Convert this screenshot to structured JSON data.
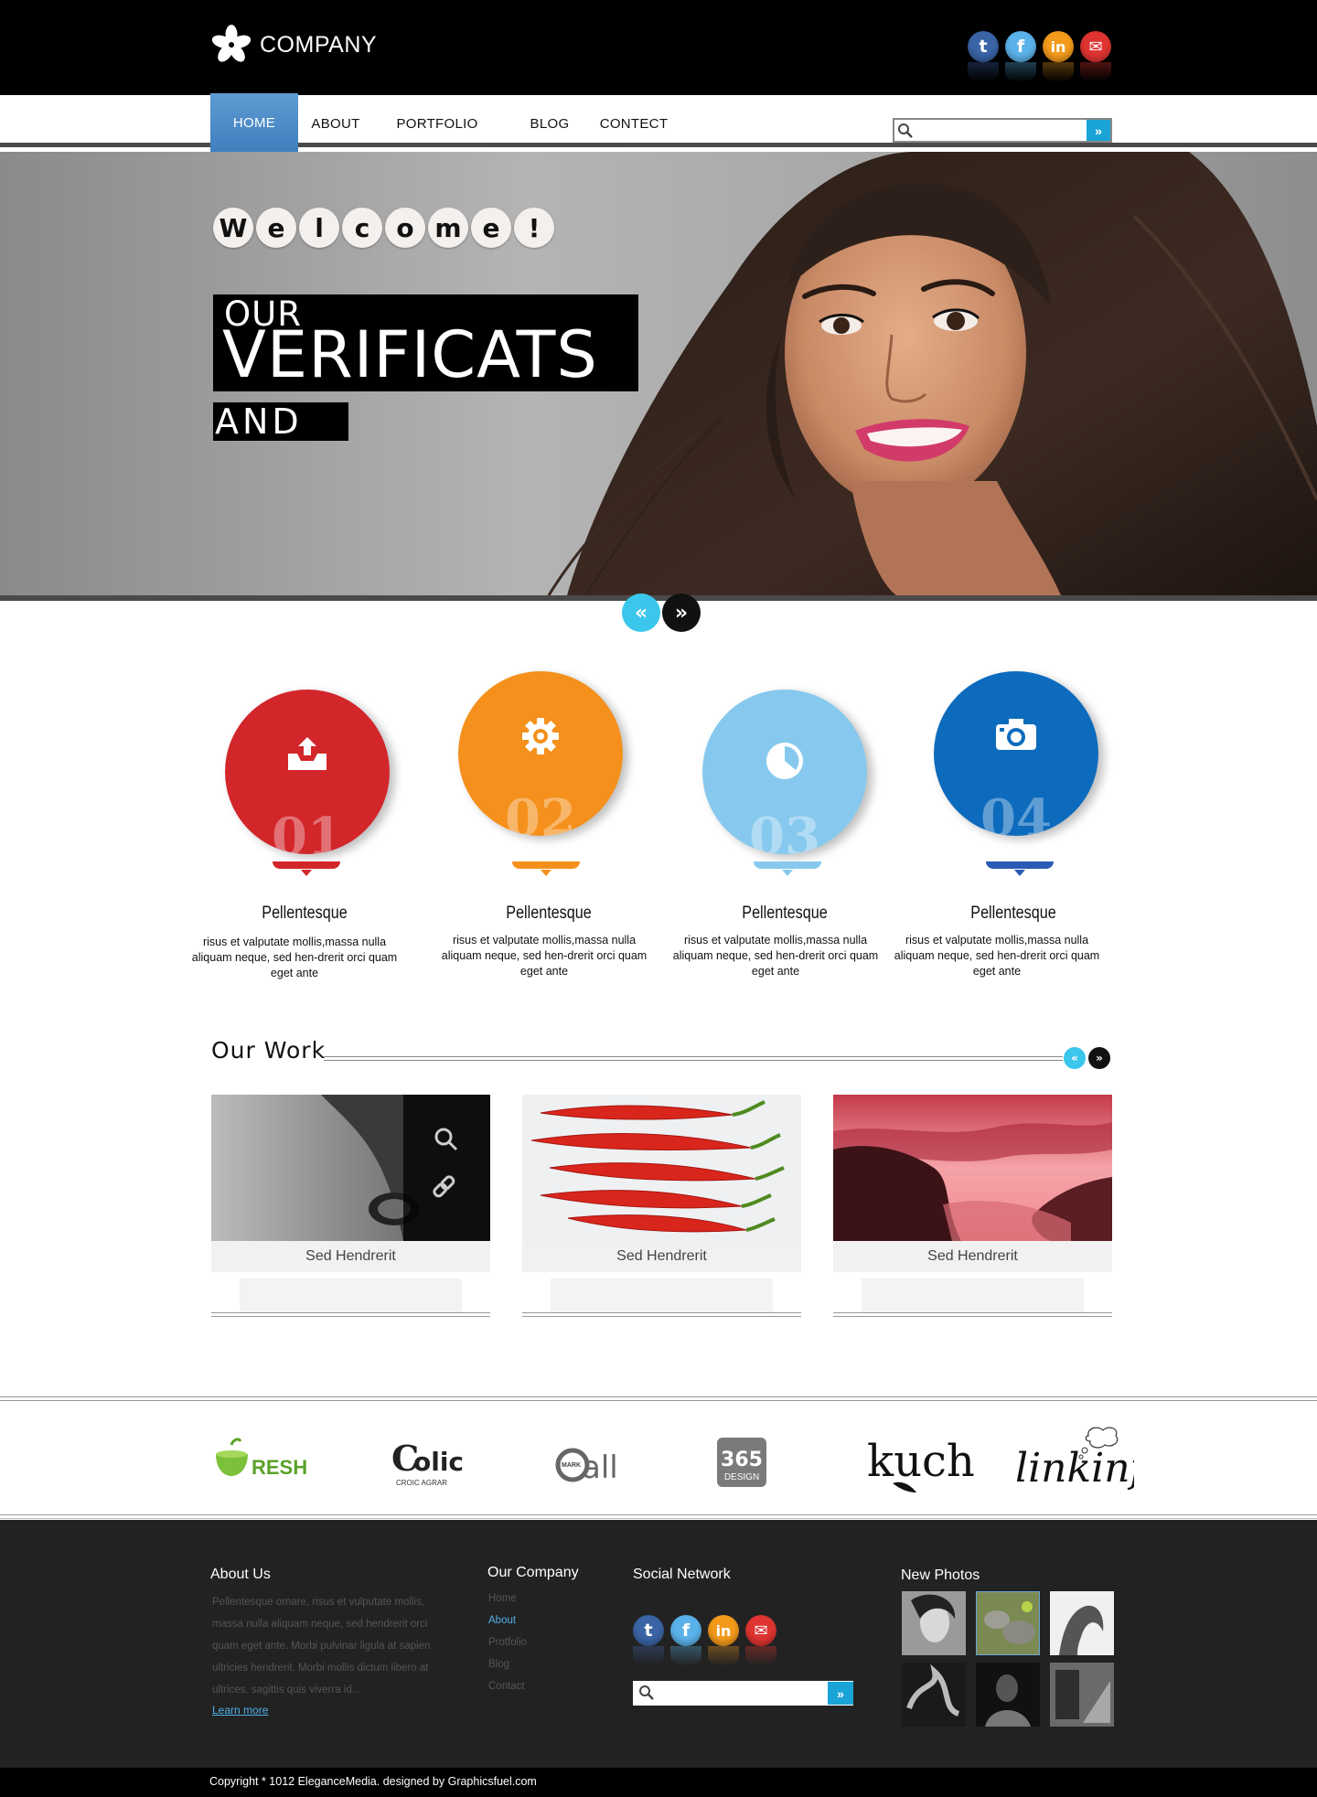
{
  "brand": {
    "logo_text": "COMPANY"
  },
  "social": [
    {
      "icon": "tumblr-icon",
      "glyph": "t",
      "color": "#3a64a6"
    },
    {
      "icon": "facebook-icon",
      "glyph": "f",
      "color": "#5bb2ea"
    },
    {
      "icon": "linkedin-icon",
      "glyph": "in",
      "color": "#f39a1b"
    },
    {
      "icon": "mail-icon",
      "glyph": "✉",
      "color": "#df3431"
    }
  ],
  "nav": {
    "items": [
      "HOME",
      "ABOUT",
      "PORTFOLIO",
      "BLOG",
      "CONTECT"
    ],
    "active": "HOME",
    "search_placeholder": ""
  },
  "hero": {
    "welcome": [
      "W",
      "e",
      "l",
      "c",
      "o",
      "m",
      "e",
      "!"
    ],
    "line1": "OUR",
    "line2": "VERIFICATS",
    "line3": "AND",
    "prev_icon": "«",
    "next_icon": "»"
  },
  "features": [
    {
      "number": "01",
      "title": "Pellentesque",
      "text": "risus et valputate mollis,massa nulla aliquam neque, sed hen-drerit orci quam eget ante",
      "color": "#d2262a",
      "icon": "inbox-upload-icon"
    },
    {
      "number": "02",
      "title": "Pellentesque",
      "text": "risus et valputate mollis,massa nulla aliquam neque, sed hen-drerit orci quam eget ante",
      "color": "#f4901b",
      "icon": "gear-icon"
    },
    {
      "number": "03",
      "title": "Pellentesque",
      "text": "risus et valputate mollis,massa nulla aliquam neque, sed hen-drerit orci quam eget ante",
      "color": "#87c9ee",
      "icon": "pie-chart-icon"
    },
    {
      "number": "04",
      "title": "Pellentesque",
      "text": "risus et valputate mollis,massa nulla aliquam neque, sed hen-drerit orci quam eget ante",
      "color": "#0d6bbd",
      "icon": "camera-icon"
    }
  ],
  "work": {
    "title": "Our Work",
    "items": [
      {
        "caption": "Sed Hendrerit",
        "image": "animal-eye-photo"
      },
      {
        "caption": "Sed Hendrerit",
        "image": "red-chili-photo"
      },
      {
        "caption": "Sed Hendrerit",
        "image": "red-sunset-coast-photo"
      }
    ]
  },
  "brands": [
    {
      "name": "fresh-logo",
      "text": "RESH"
    },
    {
      "name": "colic-logo",
      "text": "olic",
      "sub": "CROIC AGRAR"
    },
    {
      "name": "all-logo",
      "text": "all",
      "badge": "MARK"
    },
    {
      "name": "365-design-logo",
      "text": "365",
      "sub": "DESIGN"
    },
    {
      "name": "kuch-logo",
      "text": "kuch"
    },
    {
      "name": "linkinfo-logo",
      "text": "linkinfo"
    }
  ],
  "footer": {
    "about_title": "About Us",
    "about_text": "Pellentesque ornare, risus et vulputate mollis, massa nulla aliquam neque, sed hendrerit orci quam eget ante. Morbi pulvinar ligula at sapien ultricies hendrerit. Morbi mollis dictum libero at ultrices. sagittis quis viverra id...",
    "learn_more": "Learn more",
    "company_title": "Our Company",
    "company_links": [
      "Home",
      "About",
      "Protfolio",
      "Blog",
      "Contact"
    ],
    "company_selected": "About",
    "social_title": "Social Network",
    "photos_title": "New Photos",
    "copyright": "Copyright * 1012 EleganceMedia. designed by Graphicsfuel.com"
  },
  "colors": {
    "accent": "#1aa3d6",
    "nav_active": "#4f8ec9",
    "footer_bg": "#222222"
  }
}
